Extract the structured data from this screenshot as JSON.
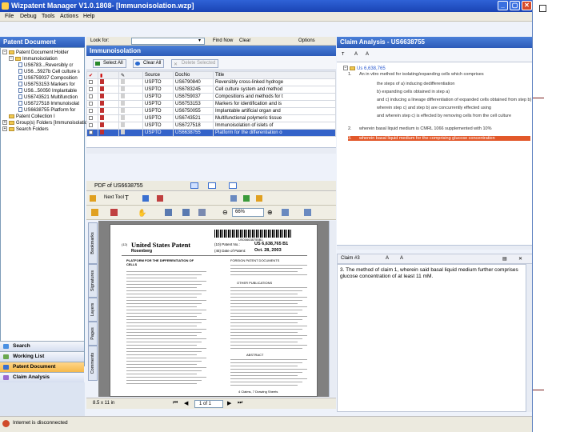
{
  "window": {
    "title": "Wizpatent Manager V1.0.1808- [Immunoisolation.wzp]",
    "controls": [
      "_",
      "▢",
      "✕"
    ]
  },
  "menu": [
    "File",
    "Debug",
    "Tools",
    "Actions",
    "Help"
  ],
  "left_panel": {
    "header": "Patent Document",
    "tree": [
      {
        "label": "Patent Document Holder",
        "level": 0,
        "type": "folder"
      },
      {
        "label": "Immunoisolation",
        "level": 1,
        "type": "folder"
      },
      {
        "label": "US6783...Reversibly cr",
        "level": 2,
        "type": "doc"
      },
      {
        "label": "US6...5927b Cell culture s",
        "level": 2,
        "type": "doc"
      },
      {
        "label": "US6759037 Composition",
        "level": 2,
        "type": "doc"
      },
      {
        "label": "US6753153 Markers for",
        "level": 2,
        "type": "doc"
      },
      {
        "label": "US6...50050 Implantable",
        "level": 2,
        "type": "doc"
      },
      {
        "label": "US6743521 Multifunction",
        "level": 2,
        "type": "doc"
      },
      {
        "label": "US6727518 Immunoisolat",
        "level": 2,
        "type": "doc"
      },
      {
        "label": "US6638755 Platform for",
        "level": 2,
        "type": "doc"
      },
      {
        "label": "Patent Collection I",
        "level": 1,
        "type": "folder"
      },
      {
        "label": "Group(s) Folders [Immunoisolation",
        "level": 0,
        "type": "folder"
      },
      {
        "label": "Search Folders",
        "level": 0,
        "type": "folder"
      }
    ],
    "nav_buttons": [
      "Search",
      "Working List",
      "Patent Document",
      "Claim Analysis"
    ],
    "active_nav": "Patent Document"
  },
  "search_bar": {
    "look_for_label": "Look for:",
    "look_for_value": "",
    "find_now": "Find Now",
    "clear": "Clear",
    "options": "Options"
  },
  "doc_list": {
    "header": "Immunoisolation",
    "buttons": {
      "select_all": "Select All",
      "clear_all": "Clear All",
      "delete": "Delete Selected"
    },
    "columns": [
      "",
      "",
      "",
      "Source",
      "DocNo",
      "Title"
    ],
    "rows": [
      {
        "source": "USPTO",
        "docno": "US6790840",
        "title": "Reversibly cross-linked hydroge"
      },
      {
        "source": "USPTO",
        "docno": "US6783245",
        "title": "Cell culture system and method"
      },
      {
        "source": "USPTO",
        "docno": "US6759037",
        "title": "Compositions and methods for t"
      },
      {
        "source": "USPTO",
        "docno": "US6753153",
        "title": "Markers for identification and is"
      },
      {
        "source": "USPTO",
        "docno": "US6750055",
        "title": "Implantable artificial organ and"
      },
      {
        "source": "USPTO",
        "docno": "US6743521",
        "title": "Multifunctional polymeric tissue"
      },
      {
        "source": "USPTO",
        "docno": "US6727518",
        "title": "Immunoisolation of islets of"
      },
      {
        "source": "USPTO",
        "docno": "US6638755",
        "title": "Platform for the differentiation o"
      }
    ],
    "selected_index": 7
  },
  "pdf_viewer": {
    "header": "PDF of US6638755",
    "zoom": "66%",
    "toolbar_text": "Next Tool",
    "side_tabs": [
      "Bookmarks",
      "Signatures",
      "Layers",
      "Pages",
      "Comments"
    ],
    "page_size": "8.5 x 11 in",
    "page_nav": "1 of 1",
    "page": {
      "barcode_number": "US006638755B1",
      "org": "(12)",
      "heading": "United States Patent",
      "inventor": "Rosenberg",
      "patent_no_label": "(10) Patent No.:",
      "patent_no": "US 6,638,765 B1",
      "date_label": "(45) Date of Patent:",
      "date": "Oct. 28, 2003",
      "abstract_label": "ABSTRACT",
      "references_label": "FOREIGN PATENT DOCUMENTS",
      "other_pubs_label": "OTHER PUBLICATIONS",
      "claims_line": "4 Claims, 7 Drawing Sheets",
      "left_title": "PLATFORM FOR THE DIFFERENTIATION OF CELLS"
    }
  },
  "claim_panel": {
    "header": "Claim Analysis - US6638755",
    "tree_root": "Us 6,638,765",
    "claims": [
      {
        "num": "1.",
        "text": "An in vitro method for isolating/expanding cells which comprises"
      },
      {
        "num": "",
        "text": "the steps of a) inducing dedifferentiation"
      },
      {
        "num": "",
        "text": "b) expanding cells obtained in step a)"
      },
      {
        "num": "",
        "text": "and c) inducing a lineage differentiation of expanded cells obtained from step b)"
      },
      {
        "num": "",
        "text": "wherein step c) and step b) are concurrently effected using"
      },
      {
        "num": "",
        "text": "and wherein step c) is effected by removing cells from the cell culture"
      },
      {
        "num": "2.",
        "text": "wherein basal liquid medium is CMRL 1066 supplemented with 10%"
      },
      {
        "num": "3.",
        "text": "wherein basal liquid medium for the comprising glucose concentration"
      }
    ],
    "selected_claim_index": 7,
    "detail_header": "Claim #3",
    "detail_text": "3. The method of claim 1, wherein said basal liquid medium further comprises glucose concentration of at least 11 mM."
  },
  "status_bar": {
    "text": "Internet is disconnected"
  },
  "colors": {
    "title_bar": "#1a44b4",
    "panel_header": "#2c5bb8",
    "selection": "#3463c9",
    "active_nav": "#f5b84a",
    "highlight_row": "#e2582a"
  }
}
